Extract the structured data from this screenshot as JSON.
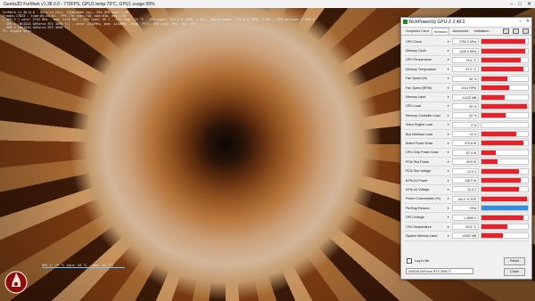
{
  "background_window": {
    "title": "Geeks3D FurMark v1.38.0.0 - 770FPS, GPU1 temp:79°C, GPU1 usage:99%",
    "overlay_lines": [
      "FurMark v1.38.0.0 - Burn-in test, 1920x1080 (ms), 99% GPU load 9.00",
      "Frames:17823 - time:00:40:03 - FPS:770 (min:740, max:838, avg:770)",
      "[ GPU-Z ] core: 2742 MHz - mem: 1430 MHz - GPU load: 99 % - GPU temp: 79 °C - GPU power: 376.6 W (PPW: 2.04) - Board power: 374.8 W (PPW: 2.05) - GPU voltage: 1.056 V",
      "- GPU 1 (NVIDIA GeForce RTX 3090 Ti) - core: 2742MHz, mem: 1430MHz, temp: 79°C, GPU load: 99%, fan: 55%",
      "- GPU 2 (NVIDIA GeForce RTX 3090 Ti)",
      "F1: toggle help"
    ],
    "bottom_caption": "GPU 1: 79 °C (min: 34 °C - max: 79 °C)"
  },
  "gpuz": {
    "title": "TechPowerUp GPU-Z 2.48.0",
    "tabs": [
      "Graphics Card",
      "Sensors",
      "Advanced",
      "Validation"
    ],
    "active_tab": "Sensors",
    "sensors": [
      {
        "label": "GPU Clock",
        "value": "2782.0 MHz",
        "level": 0.95,
        "color": "red"
      },
      {
        "label": "Memory Clock",
        "value": "1430.0 MHz",
        "level": 0.95,
        "color": "red"
      },
      {
        "label": "GPU Temperature",
        "value": "79.6 °C",
        "level": 0.85,
        "color": "red"
      },
      {
        "label": "Memory Temperature",
        "value": "87.2 °C",
        "level": 0.9,
        "color": "red"
      },
      {
        "label": "Fan Speed (%)",
        "value": "55 %",
        "level": 0.55,
        "color": "red"
      },
      {
        "label": "Fan Speed (RPM)",
        "value": "2414 RPM",
        "level": 0.6,
        "color": "red"
      },
      {
        "label": "Memory Used",
        "value": "11120 MB",
        "level": 0.5,
        "color": "red"
      },
      {
        "label": "GPU Load",
        "value": "99 %",
        "level": 0.99,
        "color": "red"
      },
      {
        "label": "Memory Controller Load",
        "value": "52 %",
        "level": 0.52,
        "color": "red"
      },
      {
        "label": "Video Engine Load",
        "value": "0 %",
        "level": 0.0,
        "color": "red"
      },
      {
        "label": "Bus Interface Load",
        "value": "74 %",
        "level": 0.74,
        "color": "red"
      },
      {
        "label": "Board Power Draw",
        "value": "379.8 W",
        "level": 0.9,
        "color": "red"
      },
      {
        "label": "GPU Chip Power Draw",
        "value": "87.4 W",
        "level": 0.3,
        "color": "red"
      },
      {
        "label": "PCIe Slot Power",
        "value": "39.5 W",
        "level": 0.35,
        "color": "red"
      },
      {
        "label": "PCIe Slot Voltage",
        "value": "12.0 V",
        "level": 0.8,
        "color": "red"
      },
      {
        "label": "8-Pin #1 Power",
        "value": "135.9 W",
        "level": 0.85,
        "color": "red"
      },
      {
        "label": "8-Pin #1 Voltage",
        "value": "12.0 V",
        "level": 0.8,
        "color": "red"
      },
      {
        "label": "Power Consumption (%)",
        "value": "104.2 % TDP",
        "level": 0.98,
        "color": "red"
      },
      {
        "label": "PerfCap Reason",
        "value": "VRel",
        "level": 1.0,
        "color": "blue"
      },
      {
        "label": "GPU Voltage",
        "value": "1.0650 V",
        "level": 0.9,
        "color": "red"
      },
      {
        "label": "CPU Temperature",
        "value": "50.6 °C",
        "level": 0.55,
        "color": "red"
      },
      {
        "label": "System Memory Used",
        "value": "14302 MB",
        "level": 0.45,
        "color": "red"
      }
    ],
    "log_to_file": "Log to file",
    "reset": "Reset",
    "gpu_select": "NVIDIA GeForce RTX 3090 Ti",
    "close": "Close"
  },
  "colors": {
    "graph_red": "#e8202a",
    "graph_blue": "#2f8fe0"
  }
}
